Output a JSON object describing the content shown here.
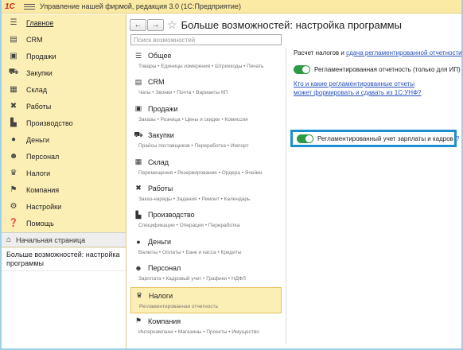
{
  "app": {
    "logo": "1С",
    "title": "Управление нашей фирмой, редакция 3.0  (1С:Предприятие)"
  },
  "sidebar": {
    "items": [
      {
        "label": "Главное",
        "icon": "menu-lines-icon",
        "glyph": "☰"
      },
      {
        "label": "CRM",
        "icon": "crm-icon",
        "glyph": "▤"
      },
      {
        "label": "Продажи",
        "icon": "cart-icon",
        "glyph": "▣"
      },
      {
        "label": "Закупки",
        "icon": "truck-icon",
        "glyph": "⛟"
      },
      {
        "label": "Склад",
        "icon": "warehouse-icon",
        "glyph": "▦"
      },
      {
        "label": "Работы",
        "icon": "tools-icon",
        "glyph": "✖"
      },
      {
        "label": "Производство",
        "icon": "factory-icon",
        "glyph": "▙"
      },
      {
        "label": "Деньги",
        "icon": "money-icon",
        "glyph": "●"
      },
      {
        "label": "Персонал",
        "icon": "person-icon",
        "glyph": "☻"
      },
      {
        "label": "Налоги",
        "icon": "emblem-icon",
        "glyph": "♛"
      },
      {
        "label": "Компания",
        "icon": "flag-icon",
        "glyph": "⚑"
      },
      {
        "label": "Настройки",
        "icon": "gear-icon",
        "glyph": "⚙"
      },
      {
        "label": "Помощь",
        "icon": "help-icon",
        "glyph": "❓"
      }
    ],
    "home": {
      "label": "Начальная страница",
      "glyph": "⌂"
    },
    "open_windows": [
      "Больше возможностей: настройка программы"
    ]
  },
  "header": {
    "back": "←",
    "forward": "→",
    "star": "☆",
    "title": "Больше возможностей: настройка программы"
  },
  "search": {
    "placeholder": "Поиск возможностей"
  },
  "sections": [
    {
      "name": "Общее",
      "glyph": "☰",
      "icon": "menu-lines-icon",
      "sub": "Товары • Единицы измерения • Штрихкоды • Печать"
    },
    {
      "name": "CRM",
      "glyph": "▤",
      "icon": "crm-icon",
      "sub": "Чаты • Звонки • Почта • Варианты КП"
    },
    {
      "name": "Продажи",
      "glyph": "▣",
      "icon": "cart-icon",
      "sub": "Заказы • Розница • Цены и скидки • Комиссия"
    },
    {
      "name": "Закупки",
      "glyph": "⛟",
      "icon": "truck-icon",
      "sub": "Прайсы поставщиков • Переработка • Импорт"
    },
    {
      "name": "Склад",
      "glyph": "▦",
      "icon": "warehouse-icon",
      "sub": "Перемещения • Резервирование • Ордера • Ячейки"
    },
    {
      "name": "Работы",
      "glyph": "✖",
      "icon": "tools-icon",
      "sub": "Заказ-наряды • Задания • Ремонт • Календарь"
    },
    {
      "name": "Производство",
      "glyph": "▙",
      "icon": "factory-icon",
      "sub": "Спецификации • Операции • Переработка"
    },
    {
      "name": "Деньги",
      "glyph": "●",
      "icon": "money-icon",
      "sub": "Валюты • Оплаты • Банк и касса • Кредиты"
    },
    {
      "name": "Персонал",
      "glyph": "☻",
      "icon": "person-icon",
      "sub": "Зарплата • Кадровый учет • Графики • НДФЛ"
    },
    {
      "name": "Налоги",
      "glyph": "♛",
      "icon": "emblem-icon",
      "sub": "Регламентированная отчетность"
    },
    {
      "name": "Компания",
      "glyph": "⚑",
      "icon": "flag-icon",
      "sub": "Интеркампани • Магазины • Проекты • Имущество"
    }
  ],
  "active_section_index": 9,
  "right": {
    "head_text": "Расчет налогов и ",
    "head_link": "сдача регламентированной отчетности",
    "toggle1": {
      "label": "Регламентированная отчетность (только для ИП)",
      "q": "?"
    },
    "link_line1": "Кто и какие регламентированные отчеты",
    "link_line2": "может формировать и сдавать из 1С:УНФ?",
    "toggle2": {
      "label": "Регламентированный учет зарплаты и кадров",
      "q": "?"
    }
  },
  "colors": {
    "accent_yellow": "#fcefb5",
    "toggle_on": "#2e9a45",
    "highlight_border": "#1b8fd0",
    "link": "#2a52be"
  }
}
